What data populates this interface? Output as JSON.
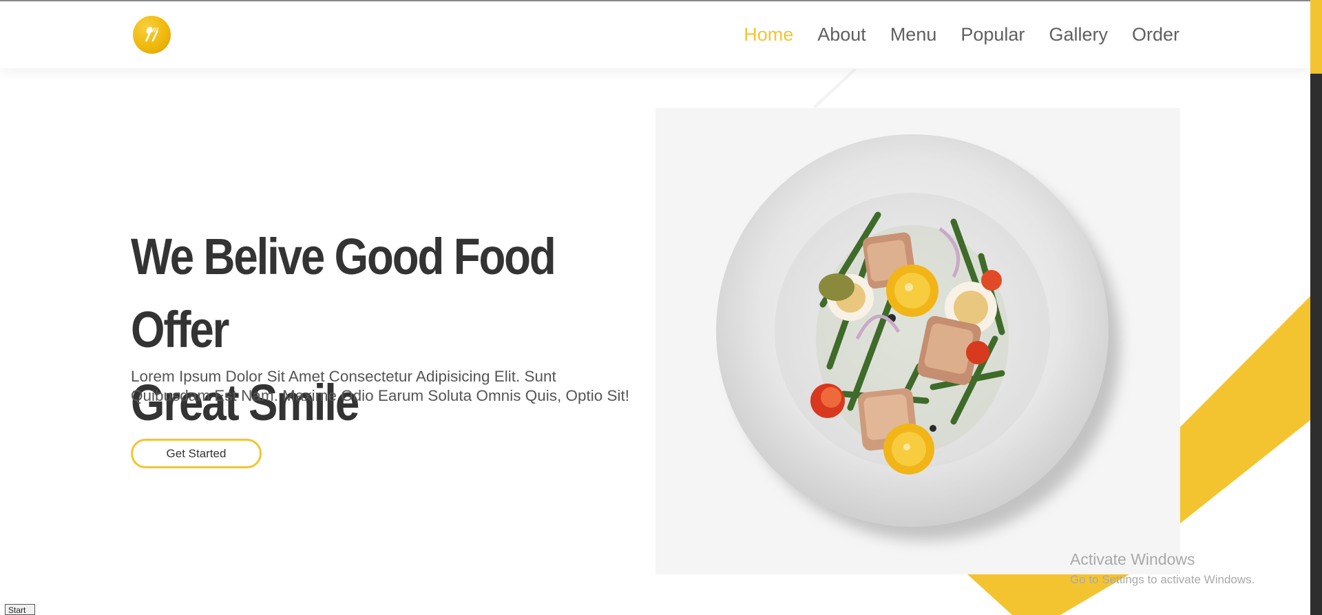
{
  "nav": {
    "logo_icon": "spoon-fork-icon",
    "links": [
      {
        "label": "Home",
        "active": true
      },
      {
        "label": "About",
        "active": false
      },
      {
        "label": "Menu",
        "active": false
      },
      {
        "label": "Popular",
        "active": false
      },
      {
        "label": "Gallery",
        "active": false
      },
      {
        "label": "Order",
        "active": false
      }
    ]
  },
  "hero": {
    "title_line1": "We Belive Good Food Offer",
    "title_line2": "Great Smile",
    "description_line1": "Lorem Ipsum Dolor Sit Amet Consectetur Adipisicing Elit. Sunt",
    "description_line2": "Quibusdam Est Nam. Maxime Odio Earum Soluta Omnis Quis, Optio Sit!",
    "cta_label": "Get Started",
    "image_icon": "salad-plate-image"
  },
  "watermark": {
    "line1": "Activate Windows",
    "line2": "Go to Settings to activate Windows."
  },
  "taskbar": {
    "start_label": "Start"
  },
  "colors": {
    "accent": "#f4c430",
    "text_dark": "#333333",
    "text_muted": "#5f5f5f",
    "scrollbar_track": "#2e2e2e"
  }
}
